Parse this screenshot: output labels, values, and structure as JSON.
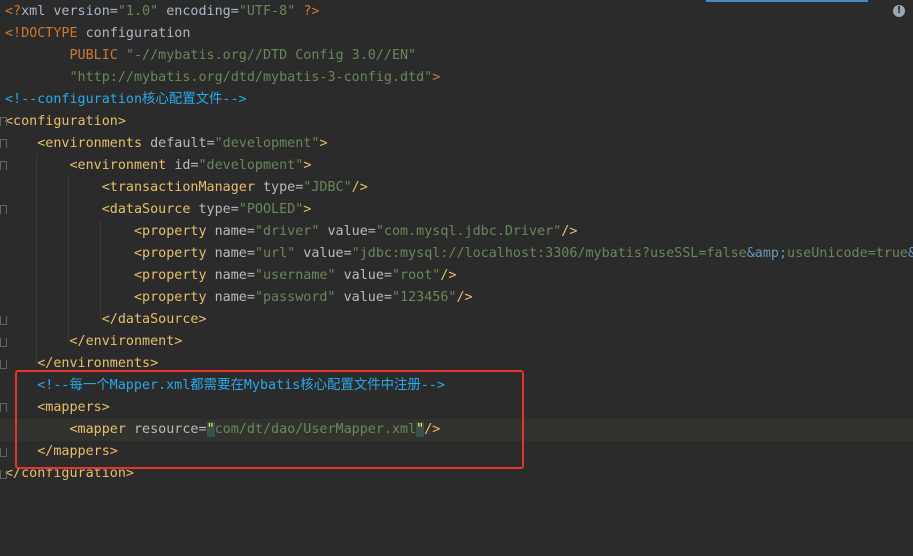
{
  "editor": {
    "lines": [
      [
        [
          "c-kw",
          "<?"
        ],
        [
          "c-plain",
          "xml version="
        ],
        [
          "c-val",
          "\"1.0\""
        ],
        [
          "c-plain",
          " encoding="
        ],
        [
          "c-val",
          "\"UTF-8\""
        ],
        [
          "c-plain",
          " "
        ],
        [
          "c-kw",
          "?>"
        ]
      ],
      [
        [
          "c-kw",
          "<!DOCTYPE "
        ],
        [
          "c-plain",
          "configuration"
        ]
      ],
      [
        [
          "c-kw",
          "        PUBLIC "
        ],
        [
          "c-val",
          "\"-//mybatis.org//DTD Config 3.0//EN\""
        ]
      ],
      [
        [
          "c-val",
          "        \"http://mybatis.org/dtd/mybatis-3-config.dtd\""
        ],
        [
          "c-kw",
          ">"
        ]
      ],
      [
        [
          "c-cmt",
          "<!--configuration核心配置文件-->"
        ]
      ],
      [
        [
          "c-tag",
          "<configuration>"
        ]
      ],
      [
        [
          "c-tag",
          "    <environments "
        ],
        [
          "c-attr",
          "default"
        ],
        [
          "c-plain",
          "="
        ],
        [
          "c-val",
          "\"development\""
        ],
        [
          "c-tag",
          ">"
        ]
      ],
      [
        [
          "c-tag",
          "        <environment "
        ],
        [
          "c-attr",
          "id"
        ],
        [
          "c-plain",
          "="
        ],
        [
          "c-val",
          "\"development\""
        ],
        [
          "c-tag",
          ">"
        ]
      ],
      [
        [
          "c-tag",
          "            <transactionManager "
        ],
        [
          "c-attr",
          "type"
        ],
        [
          "c-plain",
          "="
        ],
        [
          "c-val",
          "\"JDBC\""
        ],
        [
          "c-tag",
          "/>"
        ]
      ],
      [
        [
          "c-tag",
          "            <dataSource "
        ],
        [
          "c-attr",
          "type"
        ],
        [
          "c-plain",
          "="
        ],
        [
          "c-val",
          "\"POOLED\""
        ],
        [
          "c-tag",
          ">"
        ]
      ],
      [
        [
          "c-tag",
          "                <property "
        ],
        [
          "c-attr",
          "name"
        ],
        [
          "c-plain",
          "="
        ],
        [
          "c-val",
          "\"driver\""
        ],
        [
          "c-plain",
          " "
        ],
        [
          "c-attr",
          "value"
        ],
        [
          "c-plain",
          "="
        ],
        [
          "c-val",
          "\"com.mysql.jdbc.Driver\""
        ],
        [
          "c-tag",
          "/>"
        ]
      ],
      [
        [
          "c-tag",
          "                <property "
        ],
        [
          "c-attr",
          "name"
        ],
        [
          "c-plain",
          "="
        ],
        [
          "c-val",
          "\"url\""
        ],
        [
          "c-plain",
          " "
        ],
        [
          "c-attr",
          "value"
        ],
        [
          "c-plain",
          "="
        ],
        [
          "c-val",
          "\"jdbc:mysql://localhost:3306/mybatis?useSSL=false"
        ],
        [
          "c-ent",
          "&amp;"
        ],
        [
          "c-val",
          "useUnicode=true"
        ],
        [
          "c-ent",
          "&a"
        ]
      ],
      [
        [
          "c-tag",
          "                <property "
        ],
        [
          "c-attr",
          "name"
        ],
        [
          "c-plain",
          "="
        ],
        [
          "c-val",
          "\"username\""
        ],
        [
          "c-plain",
          " "
        ],
        [
          "c-attr",
          "value"
        ],
        [
          "c-plain",
          "="
        ],
        [
          "c-val",
          "\"root\""
        ],
        [
          "c-tag",
          "/>"
        ]
      ],
      [
        [
          "c-tag",
          "                <property "
        ],
        [
          "c-attr",
          "name"
        ],
        [
          "c-plain",
          "="
        ],
        [
          "c-val",
          "\"password\""
        ],
        [
          "c-plain",
          " "
        ],
        [
          "c-attr",
          "value"
        ],
        [
          "c-plain",
          "="
        ],
        [
          "c-val",
          "\"123456\""
        ],
        [
          "c-tag",
          "/>"
        ]
      ],
      [
        [
          "c-tag",
          "            </dataSource>"
        ]
      ],
      [
        [
          "c-tag",
          "        </environment>"
        ]
      ],
      [
        [
          "c-tag",
          "    </environments>"
        ]
      ],
      [
        [
          "c-cmt",
          "    <!--每一个Mapper.xml都需要在Mybatis核心配置文件中注册-->"
        ]
      ],
      [
        [
          "c-tag",
          "    <mappers>"
        ]
      ],
      [
        [
          "c-tag",
          "        <mapper "
        ],
        [
          "c-attr",
          "resource"
        ],
        [
          "c-plain",
          "="
        ],
        [
          "caret-q",
          "\""
        ],
        [
          "c-val",
          "com/dt/dao/UserMapper.xml"
        ],
        [
          "caret-q",
          "\""
        ],
        [
          "c-tag",
          "/>"
        ]
      ],
      [
        [
          "c-tag",
          "    </mappers>"
        ]
      ],
      [
        [
          "c-tag",
          "</configuration>"
        ]
      ]
    ],
    "fold_markers": [
      {
        "line": 5,
        "kind": "start"
      },
      {
        "line": 6,
        "kind": "start"
      },
      {
        "line": 7,
        "kind": "start"
      },
      {
        "line": 9,
        "kind": "start"
      },
      {
        "line": 14,
        "kind": "end"
      },
      {
        "line": 15,
        "kind": "end"
      },
      {
        "line": 16,
        "kind": "end"
      },
      {
        "line": 18,
        "kind": "start"
      },
      {
        "line": 20,
        "kind": "end"
      },
      {
        "line": 21,
        "kind": "end"
      }
    ],
    "highlighted_line": 19,
    "annotation_color": "#e5352b"
  }
}
